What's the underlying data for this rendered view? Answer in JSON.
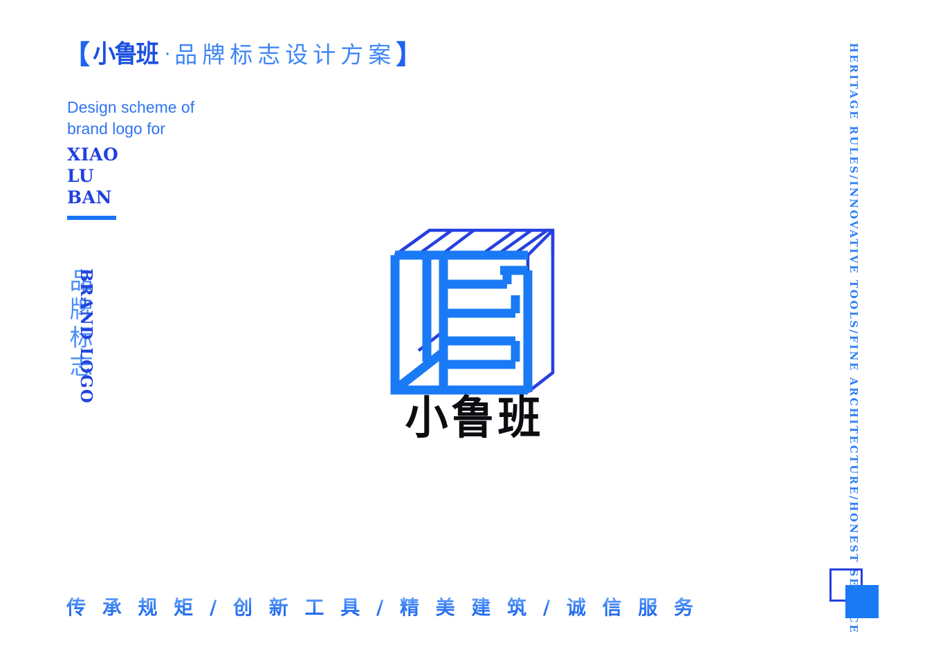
{
  "page": {
    "background_color": "#ffffff",
    "accent_bright": "#1a7af5",
    "accent_deep": "#2540e0",
    "accent_mid": "#3f86f5",
    "ink": "#0c0d11"
  },
  "header": {
    "bracket_open": "【",
    "brand_cn": "小鲁班",
    "separator_dot": "·",
    "subtitle_cn": "品牌标志设计方案",
    "bracket_close": "】"
  },
  "intro": {
    "line1": "Design scheme of",
    "line2": "brand logo for",
    "pinyin_line1": "XIAO",
    "pinyin_line2": "LU",
    "pinyin_line3": "BAN"
  },
  "vertical_left": {
    "cn": "品牌标志",
    "en": "BRAND LOGO"
  },
  "right_rail": {
    "text": "HERITAGE RULES/INNOVATIVE TOOLS/FINE ARCHITECTURE/HONEST SERVICE"
  },
  "logo": {
    "icon_name": "xiaoluban-cube-logo",
    "wordmark": "小鲁班",
    "cube_front_color": "#1a7af5",
    "cube_edge_color": "#2540e0"
  },
  "tagline": {
    "text": "传 承 规 矩 / 创 新 工 具 / 精 美 建 筑 / 诚 信 服 务"
  },
  "corner_marks": {
    "outline_square_color": "#2540e0",
    "filled_square_color": "#1a7af5"
  }
}
